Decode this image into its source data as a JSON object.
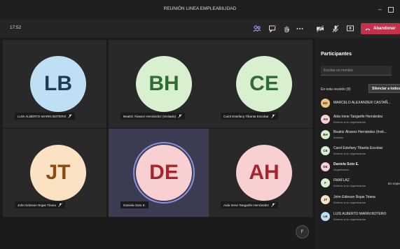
{
  "window": {
    "title": "REUNIÓN LINEA EMPLEABILIDAD"
  },
  "toolbar": {
    "time": "17:52",
    "leave_label": "Abandonar"
  },
  "tiles": [
    {
      "initials": "LB",
      "name": "LUIS ALBERTO MARIN BOTERO",
      "bg": "#bfe0f4",
      "fg": "#1f3a57",
      "muted": true
    },
    {
      "initials": "BH",
      "name": "Beatriz Álvarez Hernández (Invitado)",
      "bg": "#d8efd0",
      "fg": "#2e6b35",
      "muted": true
    },
    {
      "initials": "CE",
      "name": "Carol Estefany Tibanta Escobar",
      "bg": "#d8efd0",
      "fg": "#2e6b35",
      "muted": true
    },
    {
      "initials": "JT",
      "name": "John Edinson Rojas Triana",
      "bg": "#fbe2c2",
      "fg": "#8a4b13",
      "muted": true
    },
    {
      "initials": "DE",
      "name": "Daniela Soto E.",
      "bg": "#f8d0d2",
      "fg": "#a4262c",
      "muted": false,
      "active": true
    },
    {
      "initials": "AH",
      "name": "Aida Irene Tangarife Hernández",
      "bg": "#f8d0d2",
      "fg": "#a4262c",
      "muted": true
    }
  ],
  "self_view": {
    "initials": "F"
  },
  "panel": {
    "title": "Participantes",
    "search_placeholder": "Escribe un nombre",
    "section_label": "En esta reunión (8)",
    "mute_all_label": "Silenciar a todos",
    "participants": [
      {
        "initials": "MC",
        "name": "MARCELO ALEXANDER CASTAÑ...",
        "sub": "",
        "color": "#f4c27a"
      },
      {
        "initials": "AH",
        "name": "Aida Irene Tangarife Hernández",
        "sub": "Externo a su organización",
        "color": "#f8d0d2"
      },
      {
        "initials": "BH",
        "name": "Beatriz Álvarez Hernández (Invit...",
        "sub": "Invitado",
        "color": "#d8efd0"
      },
      {
        "initials": "CE",
        "name": "Carol Estefany Tibanta Escobar",
        "sub": "Externo a su organización",
        "color": "#d8efd0"
      },
      {
        "initials": "DE",
        "name": "Daniela Soto E.",
        "sub": "Organizador",
        "color": "#f8d0d2"
      },
      {
        "initials": "F",
        "name": "FMAFLAZ",
        "sub": "Externo a su organización",
        "color": "#d8efd0",
        "extra": "En espe"
      },
      {
        "initials": "JT",
        "name": "John Edinson Rojas Triana",
        "sub": "Externo a su organización",
        "color": "#fbe2c2"
      },
      {
        "initials": "LB",
        "name": "LUIS ALBERTO MARIN BOTERO",
        "sub": "Externo a su organización",
        "color": "#bfe0f4"
      }
    ]
  }
}
